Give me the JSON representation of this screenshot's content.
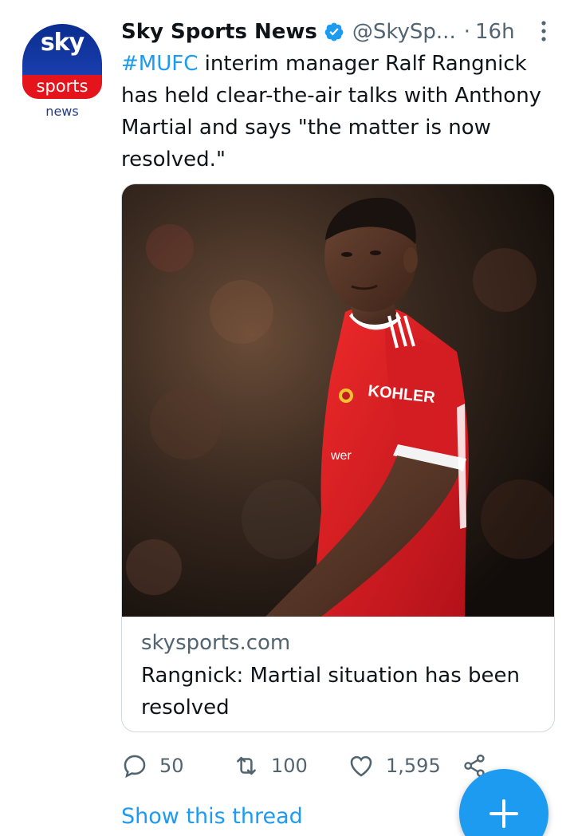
{
  "avatar": {
    "logo_top": "sky",
    "logo_middle": "sports",
    "logo_bottom": "news"
  },
  "header": {
    "display_name": "Sky Sports News",
    "handle": "@SkySp...",
    "separator": "·",
    "time": "16h"
  },
  "tweet": {
    "hashtag": "#MUFC",
    "text": " interim manager Ralf Rangnick has held clear-the-air talks with Anthony Martial and says \"the matter is now resolved.\""
  },
  "card": {
    "photo_text_sponsor": "KOHLER",
    "photo_text_sleeve": "wer",
    "domain": "skysports.com",
    "title": "Rangnick: Martial situation has been resolved"
  },
  "actions": {
    "replies": "50",
    "retweets": "100",
    "likes": "1,595"
  },
  "footer": {
    "show_thread": "Show this thread"
  },
  "colors": {
    "accent": "#1d9bf0",
    "secondary_text": "#536471",
    "primary_text": "#0f1419"
  }
}
